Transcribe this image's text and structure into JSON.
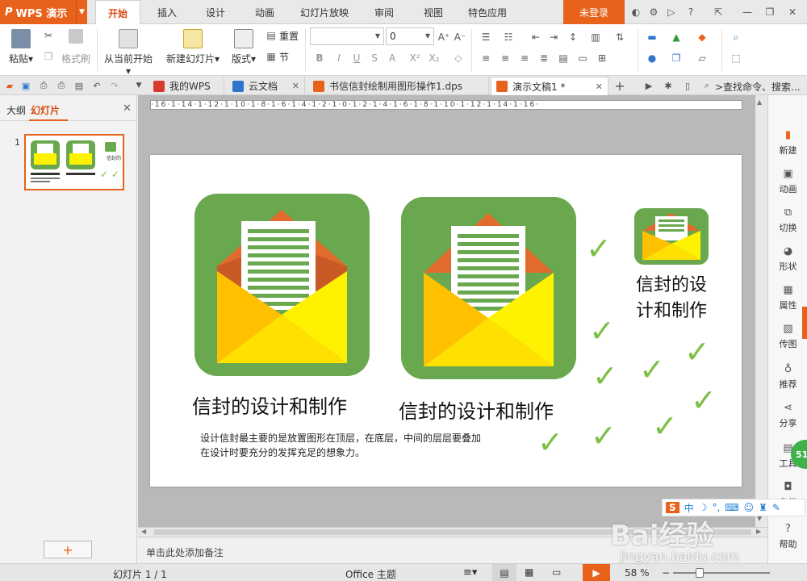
{
  "app": {
    "name": "WPS 演示",
    "logo": "P"
  },
  "menu": {
    "tabs": [
      {
        "label": "开始",
        "active": true
      },
      {
        "label": "插入"
      },
      {
        "label": "设计"
      },
      {
        "label": "动画"
      },
      {
        "label": "幻灯片放映"
      },
      {
        "label": "审阅"
      },
      {
        "label": "视图"
      },
      {
        "label": "特色应用"
      }
    ],
    "login": "未登录"
  },
  "ribbon": {
    "paste": "粘贴",
    "format_painter": "格式刷",
    "from_current": "从当前开始",
    "new_slide": "新建幻灯片",
    "layout": "版式",
    "reset": "重置",
    "section": "节",
    "font_name": "",
    "font_size": "0",
    "bold": "B",
    "italic": "I",
    "underline": "U",
    "strike": "S",
    "font_color": "A",
    "superscript": "X²",
    "subscript": "X₂"
  },
  "tabbar": {
    "tabs": [
      {
        "label": "我的WPS",
        "icon_color": "#d63b2f"
      },
      {
        "label": "云文档",
        "icon_color": "#2e75c9"
      },
      {
        "label": "书信信封绘制用图形操作1.dps",
        "icon_color": "#e8621b"
      },
      {
        "label": "演示文稿1 *",
        "icon_color": "#e8621b",
        "active": true
      }
    ],
    "search_placeholder": ">查找命令、搜索..."
  },
  "leftpanel": {
    "tab_outline": "大纲",
    "tab_slides": "幻灯片",
    "slide_number": "1"
  },
  "ruler": {
    "labels": "·16·1·14·1·12·1·10·1·8·1·6·1·4·1·2·1·0·1·2·1·4·1·6·1·8·1·10·1·12·1·14·1·16·"
  },
  "slide": {
    "title1": "信封的设计和制作",
    "title2": "信封的设计和制作",
    "small_title": "信封的设计和制作",
    "desc_line1": "设计信封最主要的是放置图形在顶层，在底层，中间的层层要叠加",
    "desc_line2": "在设计时要充分的发挥充足的想象力。"
  },
  "rightbar": {
    "items": [
      "新建",
      "动画",
      "切换",
      "形状",
      "属性",
      "传图",
      "推荐",
      "分享",
      "工具",
      "备份",
      "帮助"
    ]
  },
  "notes": {
    "placeholder": "单击此处添加备注"
  },
  "status": {
    "slide_info": "幻灯片 1 / 1",
    "theme": "Office 主题",
    "zoom": "58 %"
  },
  "watermark": {
    "brand": "Bai经验",
    "url": "jingyan.baidu.com",
    "badge": "51"
  },
  "colors": {
    "accent": "#e8621b",
    "green": "#6aa84f",
    "envelope_yellow": "#fff200"
  }
}
